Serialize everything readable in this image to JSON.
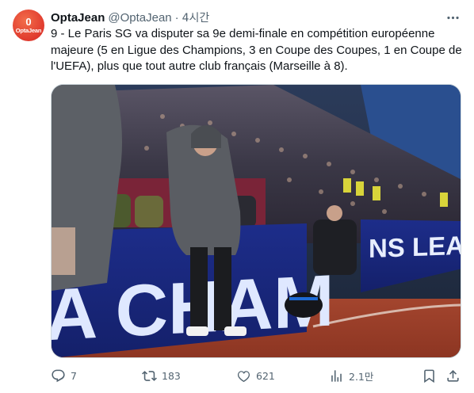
{
  "author": {
    "name": "OptaJean",
    "handle": "@OptaJean",
    "separator": "·",
    "time": "4시간",
    "avatar": {
      "glyph": "0",
      "word": "OptaJean",
      "color": "#e03a2e"
    }
  },
  "tweet": {
    "text": "9 - Le Paris SG va disputer sa 9e demi-finale en compétition européenne majeure (5 en Ligue des Champions, 3 en Coupe des Coupes, 1 en Coupe de l'UEFA), plus que tout autre club français (Marseille à 8)."
  },
  "media": {
    "board_text_left": "A CHAM",
    "board_text_right": "NS LEAGUE"
  },
  "actions": {
    "replies": "7",
    "retweets": "183",
    "likes": "621",
    "views": "2.1만"
  },
  "icons": {
    "more": "more-icon",
    "reply": "reply-icon",
    "retweet": "retweet-icon",
    "like": "like-icon",
    "views": "views-icon",
    "bookmark": "bookmark-icon",
    "share": "share-icon"
  },
  "colors": {
    "text": "#0f1419",
    "secondary": "#536471",
    "border": "#cfd9de"
  }
}
